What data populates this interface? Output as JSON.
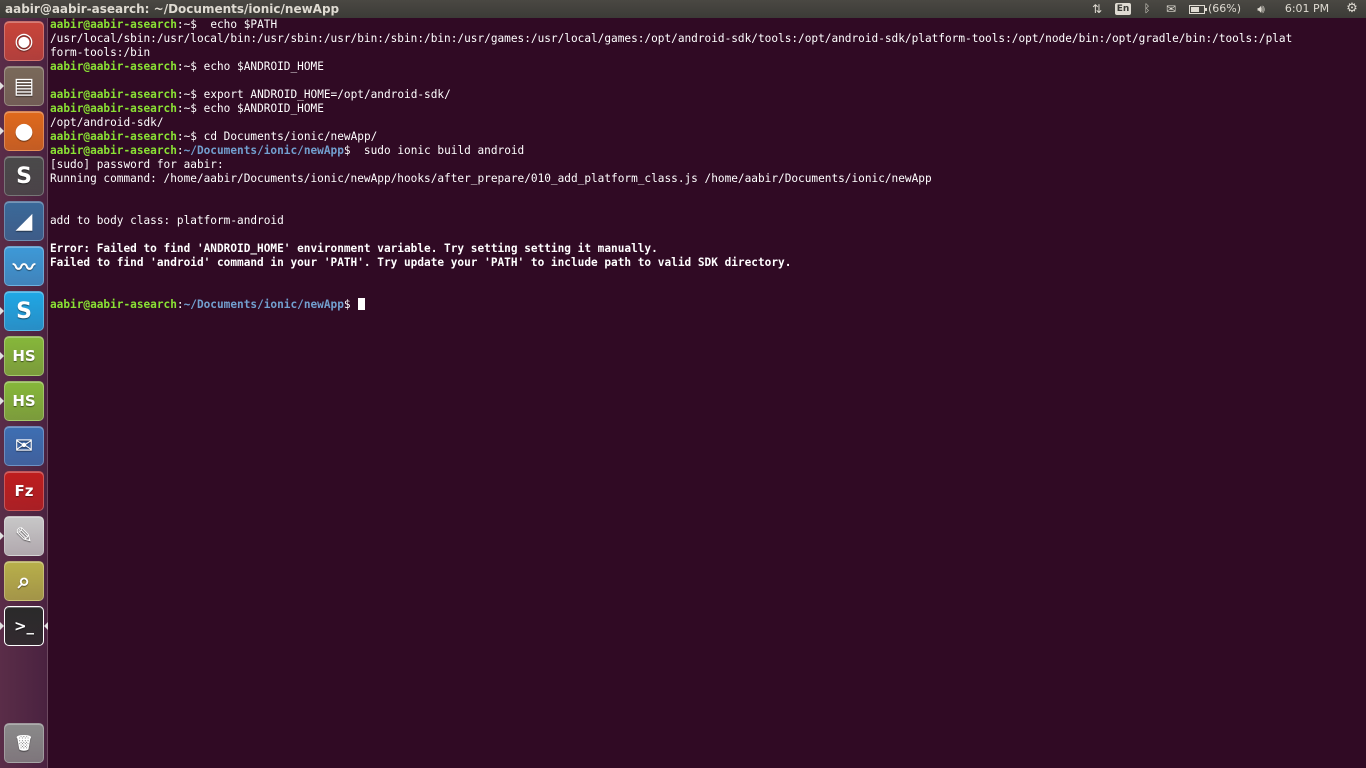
{
  "top_panel": {
    "window_title": "aabir@aabir-asearch: ~/Documents/ionic/newApp",
    "indicators": {
      "network_icon": "network-updown-icon",
      "keyboard_layout": "En",
      "bluetooth_icon": "bluetooth-icon",
      "mail_icon": "mail-icon",
      "battery_icon": "battery-icon",
      "battery_percent": "(66%)",
      "battery_level": 0.66,
      "volume_icon": "volume-icon",
      "clock": "6:01 PM",
      "session_icon": "gear-icon"
    }
  },
  "launcher": {
    "items": [
      {
        "name": "ubuntu-dash",
        "glyph": "◉",
        "color": "#c9453a",
        "running": false
      },
      {
        "name": "files",
        "glyph": "▤",
        "color": "#7a6a5a",
        "running": true
      },
      {
        "name": "firefox",
        "glyph": "●",
        "color": "#e06a1c",
        "running": true
      },
      {
        "name": "sublime-text",
        "glyph": "S",
        "color": "#4a4a4a",
        "running": false
      },
      {
        "name": "mysql-workbench",
        "glyph": "◢",
        "color": "#3a6a9a",
        "running": false
      },
      {
        "name": "mustache-app",
        "glyph": "〰",
        "color": "#3d9ad8",
        "running": false
      },
      {
        "name": "skype",
        "glyph": "S",
        "color": "#1fa8e6",
        "running": true
      },
      {
        "name": "hotspot-shield-1",
        "glyph": "HS",
        "color": "#86b83a",
        "running": true
      },
      {
        "name": "hotspot-shield-2",
        "glyph": "HS",
        "color": "#86b83a",
        "running": true
      },
      {
        "name": "thunderbird",
        "glyph": "✉",
        "color": "#3d6fb3",
        "running": false
      },
      {
        "name": "filezilla",
        "glyph": "Fz",
        "color": "#bf1e1e",
        "running": false
      },
      {
        "name": "text-editor",
        "glyph": "✎",
        "color": "#c8c8c8",
        "running": true
      },
      {
        "name": "system-monitor",
        "glyph": "⌕",
        "color": "#b8b04a",
        "running": false
      },
      {
        "name": "terminal",
        "glyph": ">_",
        "color": "#2a2a2a",
        "running": true,
        "focused": true
      },
      {
        "name": "trash",
        "glyph": "🗑",
        "color": "#8a8a8a",
        "running": false
      }
    ]
  },
  "terminal": {
    "prompt_user": "aabir@aabir-asearch",
    "lines": [
      {
        "type": "prompt",
        "path": "~",
        "cmd": "  echo $PATH"
      },
      {
        "type": "out",
        "text": "/usr/local/sbin:/usr/local/bin:/usr/sbin:/usr/bin:/sbin:/bin:/usr/games:/usr/local/games:/opt/android-sdk/tools:/opt/android-sdk/platform-tools:/opt/node/bin:/opt/gradle/bin:/tools:/plat"
      },
      {
        "type": "out",
        "text": "form-tools:/bin"
      },
      {
        "type": "prompt",
        "path": "~",
        "cmd": " echo $ANDROID_HOME"
      },
      {
        "type": "out",
        "text": ""
      },
      {
        "type": "prompt",
        "path": "~",
        "cmd": " export ANDROID_HOME=/opt/android-sdk/"
      },
      {
        "type": "prompt",
        "path": "~",
        "cmd": " echo $ANDROID_HOME"
      },
      {
        "type": "out",
        "text": "/opt/android-sdk/"
      },
      {
        "type": "prompt",
        "path": "~",
        "cmd": " cd Documents/ionic/newApp/"
      },
      {
        "type": "prompt",
        "path": "~/Documents/ionic/newApp",
        "cmd": "  sudo ionic build android"
      },
      {
        "type": "out",
        "text": "[sudo] password for aabir:"
      },
      {
        "type": "out",
        "text": "Running command: /home/aabir/Documents/ionic/newApp/hooks/after_prepare/010_add_platform_class.js /home/aabir/Documents/ionic/newApp"
      },
      {
        "type": "out",
        "text": ""
      },
      {
        "type": "out",
        "text": ""
      },
      {
        "type": "out",
        "text": "add to body class: platform-android"
      },
      {
        "type": "out",
        "text": ""
      },
      {
        "type": "err",
        "text": "Error: Failed to find 'ANDROID_HOME' environment variable. Try setting setting it manually."
      },
      {
        "type": "err",
        "text": "Failed to find 'android' command in your 'PATH'. Try update your 'PATH' to include path to valid SDK directory."
      },
      {
        "type": "out",
        "text": ""
      },
      {
        "type": "out",
        "text": ""
      },
      {
        "type": "prompt",
        "path": "~/Documents/ionic/newApp",
        "cmd": " ",
        "cursor": true
      }
    ]
  }
}
